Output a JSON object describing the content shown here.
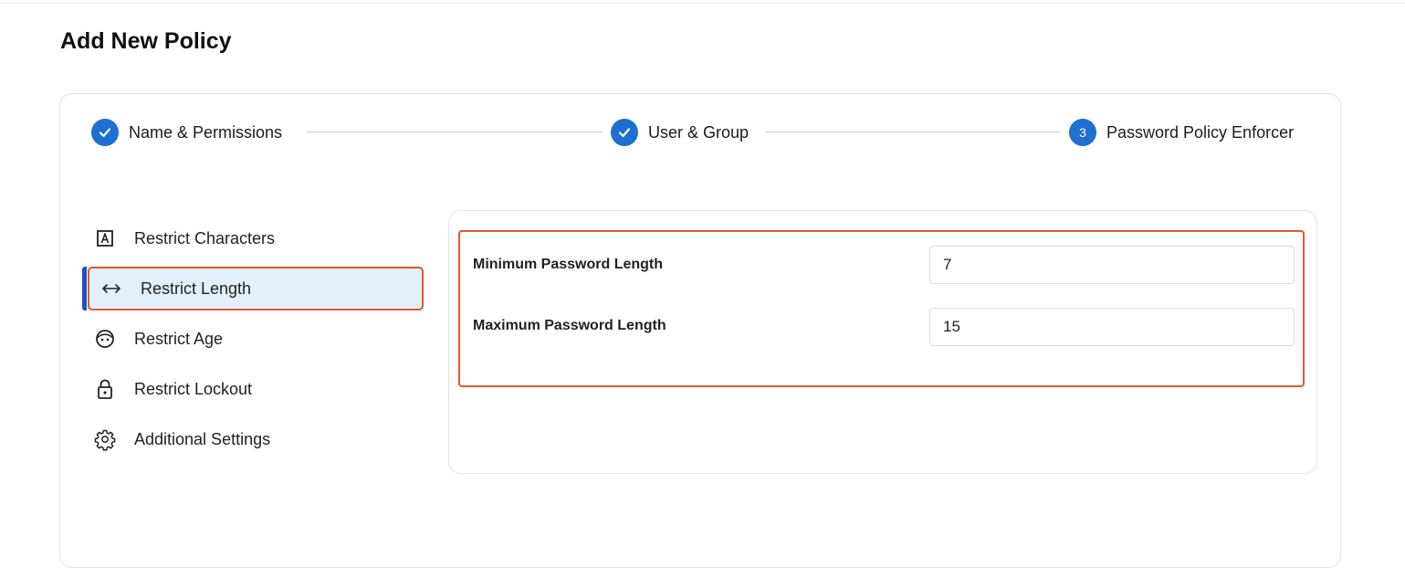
{
  "page": {
    "title": "Add New Policy"
  },
  "stepper": {
    "steps": [
      {
        "label": "Name & Permissions",
        "status": "completed",
        "icon": "check-icon"
      },
      {
        "label": "User & Group",
        "status": "completed",
        "icon": "check-icon"
      },
      {
        "label": "Password Policy Enforcer",
        "status": "current",
        "number": "3"
      }
    ]
  },
  "sidebar": {
    "items": [
      {
        "label": "Restrict Characters",
        "icon": "letter-a-box-icon",
        "active": false
      },
      {
        "label": "Restrict Length",
        "icon": "left-right-arrow-icon",
        "active": true
      },
      {
        "label": "Restrict Age",
        "icon": "face-icon",
        "active": false
      },
      {
        "label": "Restrict Lockout",
        "icon": "lock-icon",
        "active": false
      },
      {
        "label": "Additional Settings",
        "icon": "gear-icon",
        "active": false
      }
    ]
  },
  "form": {
    "min_length": {
      "label": "Minimum Password Length",
      "value": "7"
    },
    "max_length": {
      "label": "Maximum Password Length",
      "value": "15"
    }
  },
  "colors": {
    "primary": "#1f6fd1",
    "highlight_border": "#e25a2c",
    "active_bg": "#e2f0fb",
    "active_bar": "#1f4fc7"
  }
}
